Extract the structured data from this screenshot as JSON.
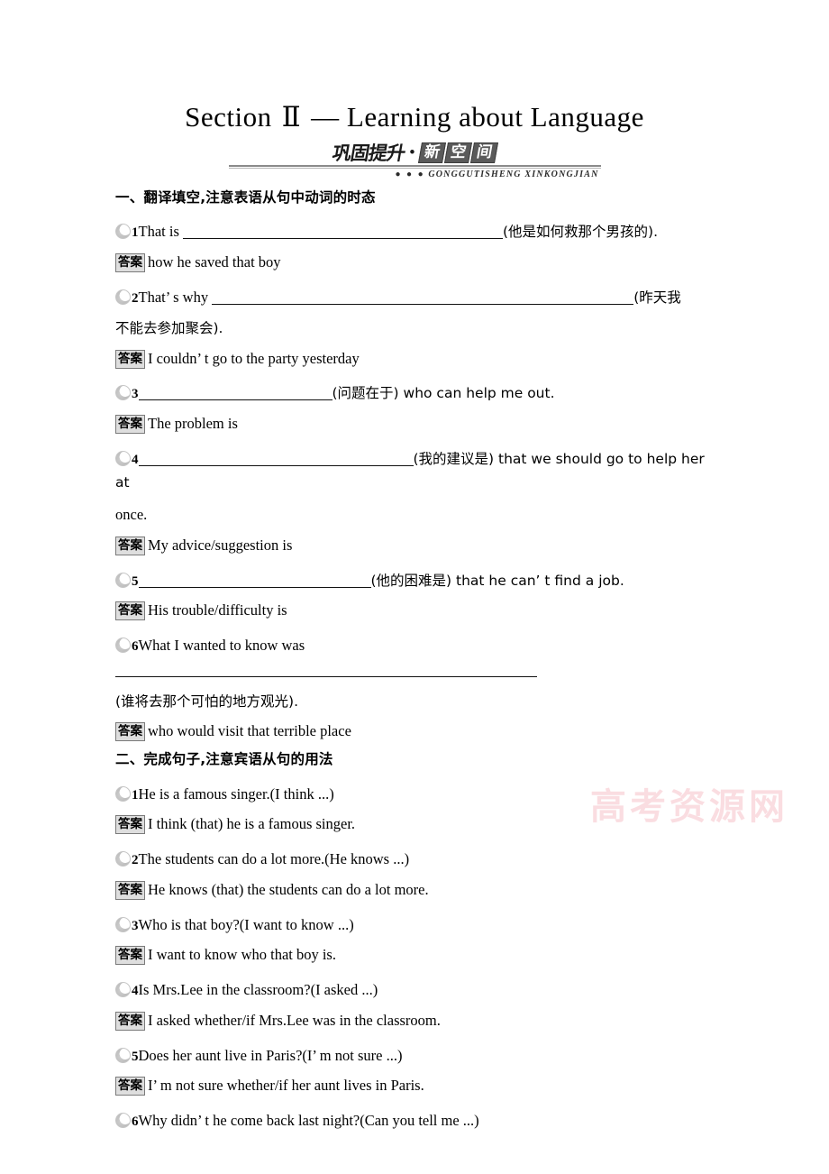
{
  "title": {
    "prefix": "Section",
    "numeral": "Ⅱ",
    "dash": "—",
    "subject": "Learning about Language"
  },
  "banner": {
    "cn_main": "巩固提升",
    "dot": "•",
    "boxed": [
      "新",
      "空",
      "间"
    ],
    "dots_lead": "● ● ●",
    "pinyin": "GONGGUTISHENG XINKONGJIAN"
  },
  "watermark": "高考资源网",
  "answer_badge": "答案",
  "sections": [
    {
      "heading": "一、翻译填空,注意表语从句中动词的时态",
      "items": [
        {
          "num": "1",
          "pre": "That is",
          "blank": "b-long",
          "post": "(他是如何救那个男孩的).",
          "continuation": "",
          "answer": "how he saved that boy"
        },
        {
          "num": "2",
          "pre": "That’ s why",
          "blank": "b-xlong",
          "post": "(昨天我",
          "continuation": "不能去参加聚会).",
          "answer": "I couldn’ t go to the party yesterday"
        },
        {
          "num": "3",
          "pre": "",
          "blank": "b-mid",
          "post": "(问题在于) who can help me out.",
          "continuation": "",
          "answer": "The problem is"
        },
        {
          "num": "4",
          "pre": "",
          "blank": "b-full",
          "post": "(我的建议是) that we should go to help her at",
          "continuation": "once.",
          "answer": "My advice/suggestion is"
        },
        {
          "num": "5",
          "pre": "",
          "blank": "b-mid2",
          "post": "(他的困难是) that he can’ t find a job.",
          "continuation": "",
          "answer": "His trouble/difficulty is"
        },
        {
          "num": "6",
          "pre": "What I wanted to know was",
          "blank": "b-xlong",
          "post": "",
          "continuation": "(谁将去那个可怕的地方观光).",
          "answer": "who would visit that terrible place"
        }
      ]
    },
    {
      "heading": "二、完成句子,注意宾语从句的用法",
      "items": [
        {
          "num": "1",
          "pre": "He is a famous singer.(I think ...)",
          "blank": "",
          "post": "",
          "continuation": "",
          "answer": "I think (that) he is a famous singer."
        },
        {
          "num": "2",
          "pre": "The students can do a lot more.(He knows ...)",
          "blank": "",
          "post": "",
          "continuation": "",
          "answer": "He knows (that) the students can do a lot more."
        },
        {
          "num": "3",
          "pre": "Who is that boy?(I want to know ...)",
          "blank": "",
          "post": "",
          "continuation": "",
          "answer": "I want to know who that boy is."
        },
        {
          "num": "4",
          "pre": "Is Mrs.Lee in the classroom?(I asked ...)",
          "blank": "",
          "post": "",
          "continuation": "",
          "answer": "I asked whether/if Mrs.Lee was in the classroom."
        },
        {
          "num": "5",
          "pre": "Does her aunt live in Paris?(I’ m not sure ...)",
          "blank": "",
          "post": "",
          "continuation": "",
          "answer": "I’ m not sure whether/if her aunt lives in Paris."
        },
        {
          "num": "6",
          "pre": "Why didn’ t he come back last night?(Can you tell me ...)",
          "blank": "",
          "post": "",
          "continuation": "",
          "answer": ""
        }
      ]
    }
  ]
}
